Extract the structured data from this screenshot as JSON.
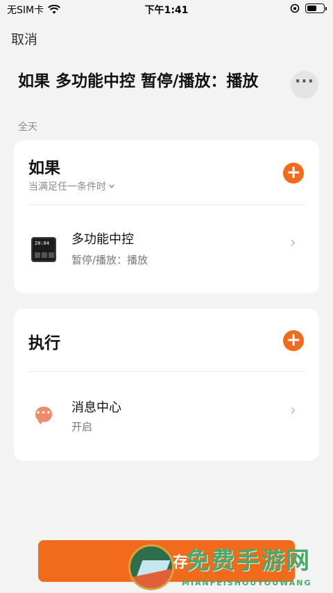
{
  "status_bar": {
    "carrier": "无SIM卡",
    "time": "下午1:41",
    "battery_level": 0.6
  },
  "header": {
    "cancel_label": "取消",
    "title": "如果 多功能中控 暂停/播放：播放",
    "subtitle": "全天",
    "more_icon": "ellipsis-icon"
  },
  "if_section": {
    "title": "如果",
    "condition_mode": "当满足任一条件时",
    "items": [
      {
        "name": "多功能中控",
        "desc": "暂停/播放：播放",
        "icon": "smart-panel-icon"
      }
    ]
  },
  "do_section": {
    "title": "执行",
    "items": [
      {
        "name": "消息中心",
        "desc": "开启",
        "icon": "message-bubble-icon"
      }
    ]
  },
  "footer": {
    "save_label": "存"
  },
  "watermark": {
    "text": "免费手游网",
    "sub": "MIANFEISHOUYOUWANG"
  },
  "colors": {
    "accent": "#f26b1d",
    "background": "#f3f3f3",
    "card": "#ffffff"
  }
}
